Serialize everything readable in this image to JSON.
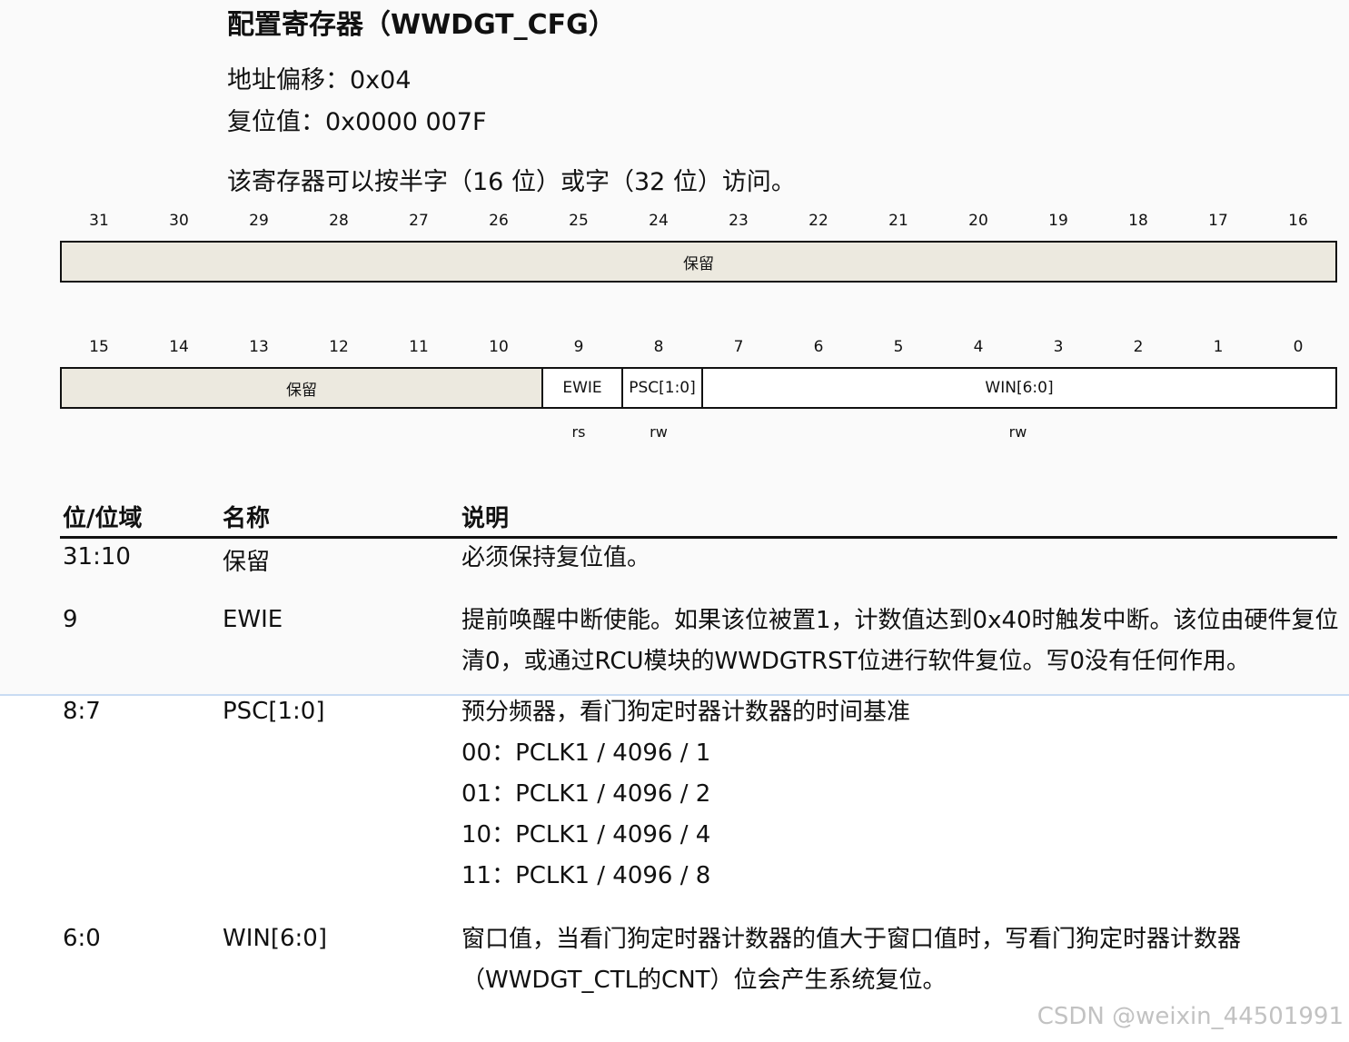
{
  "title": "配置寄存器（WWDGT_CFG）",
  "offset": "地址偏移：0x04",
  "reset": "复位值：0x0000 007F",
  "access_note": "该寄存器可以按半字（16 位）或字（32 位）访问。",
  "upper_bits": [
    "31",
    "30",
    "29",
    "28",
    "27",
    "26",
    "25",
    "24",
    "23",
    "22",
    "21",
    "20",
    "19",
    "18",
    "17",
    "16"
  ],
  "lower_bits": [
    "15",
    "14",
    "13",
    "12",
    "11",
    "10",
    "9",
    "8",
    "7",
    "6",
    "5",
    "4",
    "3",
    "2",
    "1",
    "0"
  ],
  "upper_fields": [
    {
      "name": "保留",
      "bits": 16,
      "reserved": true
    }
  ],
  "lower_fields": [
    {
      "name": "保留",
      "bits": 6,
      "reserved": true
    },
    {
      "name": "EWIE",
      "bits": 1,
      "reserved": false
    },
    {
      "name": "PSC[1:0]",
      "bits": 1,
      "reserved": false
    },
    {
      "name": "WIN[6:0]",
      "bits": 8,
      "reserved": false
    }
  ],
  "access_types": {
    "ewie": "rs",
    "psc": "rw",
    "win": "rw"
  },
  "table": {
    "headers": [
      "位/位域",
      "名称",
      "说明"
    ],
    "rows": [
      {
        "bits": "31:10",
        "name": "保留",
        "desc": [
          "必须保持复位值。"
        ]
      },
      {
        "bits": "9",
        "name": "EWIE",
        "desc": [
          "提前唤醒中断使能。如果该位被置1，计数值达到0x40时触发中断。该位由硬件复位",
          "清0，或通过RCU模块的WWDGTRST位进行软件复位。写0没有任何作用。"
        ]
      },
      {
        "bits": "8:7",
        "name": "PSC[1:0]",
        "desc": [
          "预分频器，看门狗定时器计数器的时间基准",
          "00：PCLK1 / 4096 / 1",
          "01：PCLK1 / 4096 / 2",
          "10：PCLK1 / 4096 / 4",
          "11：PCLK1 / 4096 / 8"
        ]
      },
      {
        "bits": "6:0",
        "name": "WIN[6:0]",
        "desc": [
          "窗口值，当看门狗定时器计数器的值大于窗口值时，写看门狗定时器计数器",
          "（WWDGT_CTL的CNT）位会产生系统复位。"
        ]
      }
    ]
  },
  "watermark": "CSDN @weixin_44501991"
}
